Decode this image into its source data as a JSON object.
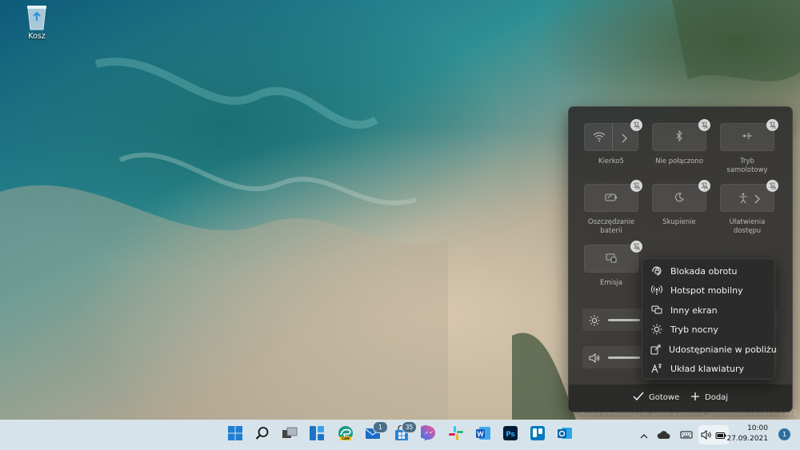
{
  "desktop": {
    "recycle_bin_label": "Kosz"
  },
  "watermark": "Kopia ewaluacyjna. Build 22463.rs_prerelease.210917-1503",
  "quick_settings": {
    "tiles": [
      {
        "label": "Kierko5",
        "icon": "wifi-icon"
      },
      {
        "label": "Nie połączono",
        "icon": "bluetooth-icon"
      },
      {
        "label": "Tryb samolotowy",
        "icon": "airplane-icon"
      },
      {
        "label": "Oszczędzanie baterii",
        "icon": "battery-saver-icon"
      },
      {
        "label": "Skupienie",
        "icon": "moon-icon"
      },
      {
        "label": "Ułatwienia dostępu",
        "icon": "accessibility-icon"
      },
      {
        "label": "Emisja",
        "icon": "cast-icon"
      }
    ],
    "footer": {
      "done_label": "Gotowe",
      "add_label": "Dodaj"
    },
    "brightness_icon": "sun-icon",
    "volume_icon": "speaker-icon"
  },
  "add_menu": {
    "items": [
      {
        "label": "Blokada obrotu",
        "icon": "rotation-lock-icon"
      },
      {
        "label": "Hotspot mobilny",
        "icon": "hotspot-icon"
      },
      {
        "label": "Inny ekran",
        "icon": "project-icon"
      },
      {
        "label": "Tryb nocny",
        "icon": "night-light-icon"
      },
      {
        "label": "Udostępnianie w pobliżu",
        "icon": "nearby-share-icon"
      },
      {
        "label": "Układ klawiatury",
        "icon": "keyboard-layout-icon"
      }
    ]
  },
  "taskbar": {
    "apps": [
      {
        "name": "start",
        "icon": "windows-logo-icon"
      },
      {
        "name": "search",
        "icon": "search-icon"
      },
      {
        "name": "task-view",
        "icon": "task-view-icon"
      },
      {
        "name": "widgets",
        "icon": "widgets-icon"
      },
      {
        "name": "edge-canary",
        "icon": "edge-canary-icon",
        "tag": "CAN"
      },
      {
        "name": "mail",
        "icon": "mail-icon",
        "badge": "1"
      },
      {
        "name": "store",
        "icon": "store-icon",
        "badge": "35"
      },
      {
        "name": "messenger",
        "icon": "messenger-icon"
      },
      {
        "name": "slack",
        "icon": "slack-icon"
      },
      {
        "name": "word",
        "icon": "word-icon"
      },
      {
        "name": "photoshop",
        "icon": "photoshop-icon",
        "text": "Ps"
      },
      {
        "name": "trello",
        "icon": "trello-icon"
      },
      {
        "name": "outlook",
        "icon": "outlook-icon"
      }
    ],
    "time": "10:00",
    "date": "27.09.2021",
    "notification_count": "1"
  }
}
